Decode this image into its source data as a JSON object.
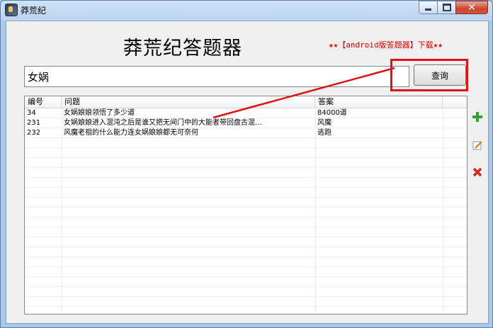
{
  "window": {
    "title": "莽荒纪"
  },
  "app": {
    "heading": "莽荒纪答题器",
    "promo": "★★【android版答题器】下载★★"
  },
  "search": {
    "value": "女娲",
    "button_label": "查询"
  },
  "table": {
    "columns": [
      "编号",
      "问题",
      "答案"
    ],
    "rows": [
      {
        "num": "34",
        "question": "女娲娘娘领悟了多少道",
        "answer": "84000道"
      },
      {
        "num": "231",
        "question": "女娲娘娘进入混沌之后是谁又把无间门中的大能者带回盘古混...",
        "answer": "风魔"
      },
      {
        "num": "232",
        "question": "风魔老祖的什么能力连女娲娘娘都无可奈何",
        "answer": "逃跑"
      }
    ]
  },
  "icons": {
    "add": "plus-icon",
    "edit": "edit-icon",
    "delete": "delete-icon"
  },
  "colors": {
    "accent_red": "#e31010",
    "add_green": "#2da52a"
  }
}
